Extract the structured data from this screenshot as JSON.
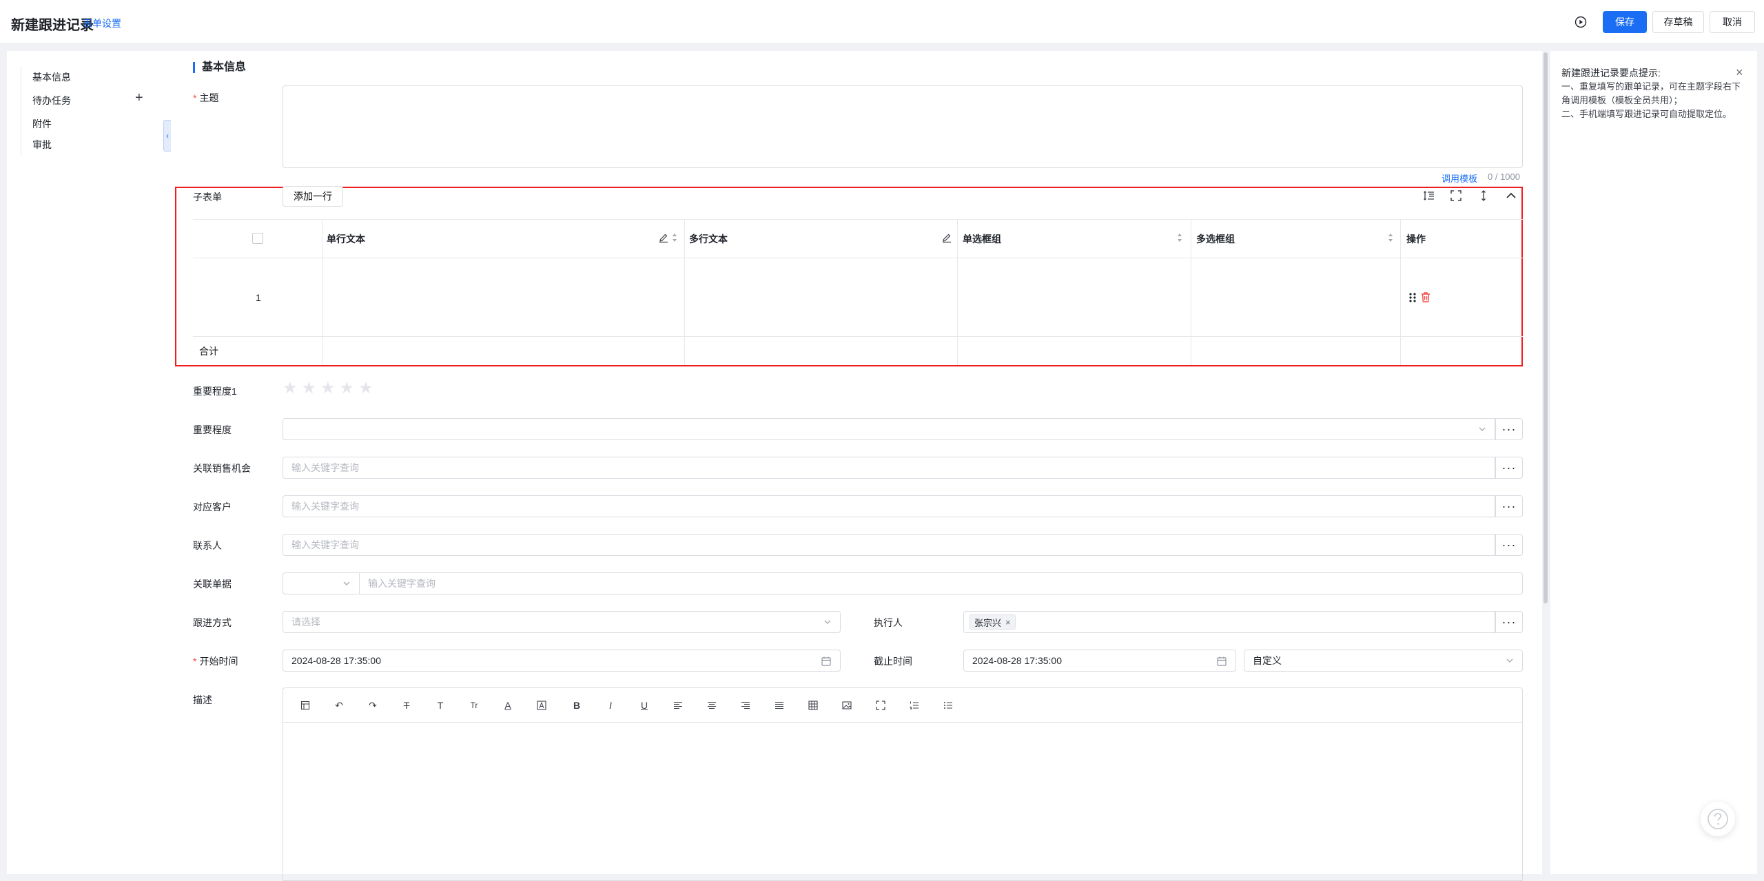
{
  "header": {
    "title": "新建跟进记录",
    "form_setting": "表单设置",
    "save": "保存",
    "draft": "存草稿",
    "cancel": "取消"
  },
  "sidebar": {
    "items": [
      {
        "label": "基本信息"
      },
      {
        "label": "待办任务"
      },
      {
        "label": "附件"
      },
      {
        "label": "审批"
      }
    ]
  },
  "form": {
    "section_title": "基本信息",
    "subject": {
      "label": "主题",
      "required": "*",
      "template_link": "调用模板",
      "counter": "0 / 1000"
    },
    "subform": {
      "label": "子表单",
      "add_row": "添加一行",
      "columns": [
        "单行文本",
        "多行文本",
        "单选框组",
        "多选框组",
        "操作"
      ],
      "rows": [
        {
          "index": "1"
        }
      ],
      "total_label": "合计"
    },
    "importance1": {
      "label": "重要程度1",
      "rating": 0,
      "max": 5
    },
    "importance": {
      "label": "重要程度",
      "value": ""
    },
    "opportunity": {
      "label": "关联销售机会",
      "placeholder": "输入关键字查询"
    },
    "customer": {
      "label": "对应客户",
      "placeholder": "输入关键字查询"
    },
    "contact": {
      "label": "联系人",
      "placeholder": "输入关键字查询"
    },
    "related_doc": {
      "label": "关联单据",
      "placeholder": "输入关键字查询"
    },
    "followup_method": {
      "label": "跟进方式",
      "placeholder": "请选择"
    },
    "executor": {
      "label": "执行人",
      "tag": "张宗兴"
    },
    "start_time": {
      "label": "开始时间",
      "required": "*",
      "value": "2024-08-28 17:35:00"
    },
    "end_time": {
      "label": "截止时间",
      "value": "2024-08-28 17:35:00",
      "mode": "自定义"
    },
    "description": {
      "label": "描述"
    }
  },
  "tips": {
    "title": "新建跟进记录要点提示:",
    "lines": [
      "一、重复填写的跟单记录，可在主题字段右下角调用模板（模板全员共用）；",
      "二、手机端填写跟进记录可自动提取定位。"
    ]
  },
  "colors": {
    "primary": "#1b6ef3",
    "danger": "#f54a45",
    "highlight_border": "#f01d1d"
  },
  "icons": {
    "play": "play-circle-icon",
    "plus": "plus-icon",
    "sort": "sort-icon",
    "edit": "edit-icon",
    "drag": "drag-icon",
    "delete": "delete-icon",
    "star": "star-icon",
    "more": "more-icon",
    "chevron": "chevron-down-icon",
    "calendar": "calendar-icon",
    "close": "close-icon",
    "help": "help-icon"
  }
}
